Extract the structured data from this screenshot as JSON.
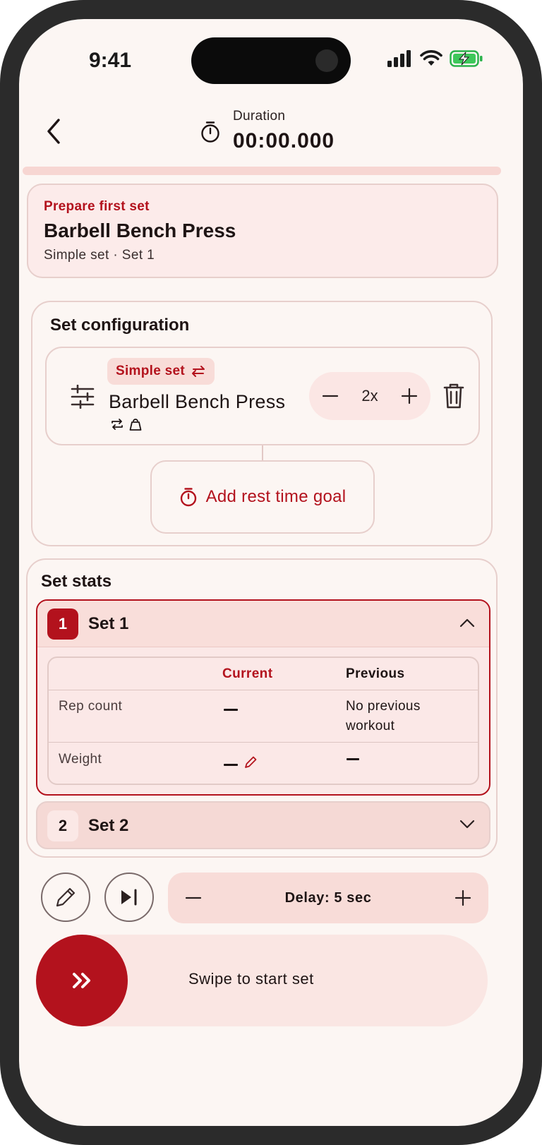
{
  "status_bar": {
    "time": "9:41"
  },
  "header": {
    "duration_label": "Duration",
    "duration_value": "00:00.000",
    "progress": 0.0
  },
  "prepare_card": {
    "kicker": "Prepare first set",
    "exercise": "Barbell Bench Press",
    "subtitle": "Simple set · Set 1"
  },
  "set_configuration": {
    "title": "Set configuration",
    "item": {
      "type_label": "Simple set",
      "exercise": "Barbell Bench Press",
      "multiplier": "2x"
    },
    "rest_button": "Add rest time goal"
  },
  "set_stats": {
    "title": "Set stats",
    "sets": [
      {
        "number": "1",
        "label": "Set 1",
        "expanded": true,
        "columns": [
          "",
          "Current",
          "Previous"
        ],
        "rows": [
          {
            "label": "Rep count",
            "current": "—",
            "previous": "No previous workout"
          },
          {
            "label": "Weight",
            "current": "—",
            "previous": "—"
          }
        ]
      },
      {
        "number": "2",
        "label": "Set 2",
        "expanded": false
      }
    ]
  },
  "controls": {
    "delay": "Delay: 5 sec",
    "swipe_text": "Swipe to start set"
  },
  "colors": {
    "accent": "#b3121d",
    "background": "#fcf6f3",
    "card": "#fcebea",
    "tint": "#f8dcd8"
  }
}
